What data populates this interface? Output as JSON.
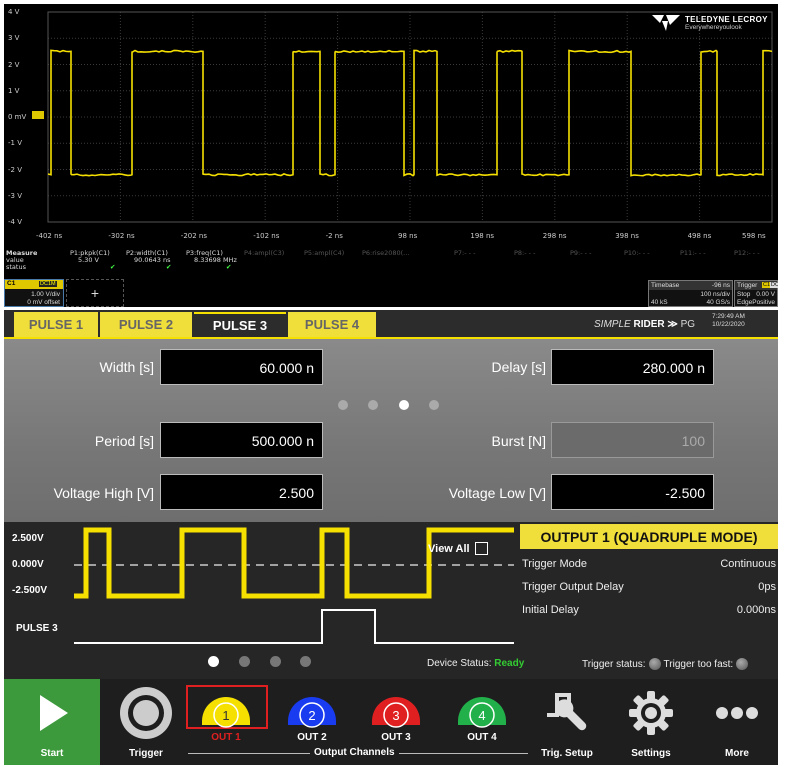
{
  "scope": {
    "y_labels": [
      "4 V",
      "3 V",
      "2 V",
      "1 V",
      "0 mV",
      "-1 V",
      "-2 V",
      "-3 V",
      "-4 V"
    ],
    "x_labels": [
      "-402 ns",
      "-302 ns",
      "-202 ns",
      "-102 ns",
      "-2 ns",
      "98 ns",
      "198 ns",
      "298 ns",
      "398 ns",
      "498 ns",
      "598 ns"
    ],
    "logo_name": "TELEDYNE LECROY",
    "logo_tag": "Everywhereyoulook",
    "measure": {
      "row_labels": [
        "Measure",
        "value",
        "status"
      ],
      "params": [
        {
          "name": "P1:pkpk(C1)",
          "value": "5.30 V",
          "status": "✔"
        },
        {
          "name": "P2:width(C1)",
          "value": "90.0643 ns",
          "status": "✔"
        },
        {
          "name": "P3:freq(C1)",
          "value": "8.33698 MHz",
          "status": "✔"
        },
        {
          "name": "P4:ampl(C3)",
          "value": "",
          "status": ""
        },
        {
          "name": "P5:ampl(C4)",
          "value": "",
          "status": ""
        },
        {
          "name": "P6:rise2080(...",
          "value": "",
          "status": ""
        },
        {
          "name": "P7:- - -",
          "value": "",
          "status": ""
        },
        {
          "name": "P8:- - -",
          "value": "",
          "status": ""
        },
        {
          "name": "P9:- - -",
          "value": "",
          "status": ""
        },
        {
          "name": "P10:- - -",
          "value": "",
          "status": ""
        },
        {
          "name": "P11:- - -",
          "value": "",
          "status": ""
        },
        {
          "name": "P12:- - -",
          "value": "",
          "status": ""
        }
      ]
    },
    "channel": {
      "name": "C1",
      "badge": "DC1M",
      "vdiv": "1.00 V/div",
      "offset": "0 mV offset"
    },
    "add_symbol": "+",
    "timebase": {
      "title": "Timebase",
      "delay": "-96 ns",
      "div": "100 ns/div",
      "samples": "40 kS",
      "rate": "40 GS/s"
    },
    "trigger": {
      "title": "Trigger",
      "ch": "C1",
      "cpl": "DC",
      "mode": "Stop",
      "level": "0.00 V",
      "type": "Edge",
      "slope": "Positive"
    }
  },
  "tabs": [
    "PULSE 1",
    "PULSE 2",
    "PULSE 3",
    "PULSE 4"
  ],
  "active_tab": 2,
  "brand": {
    "prefix": "SIMPLE",
    "name": "RIDER",
    "arrows": "≫",
    "suffix": "PG",
    "time": "7:29:49 AM",
    "date": "10/22/2020"
  },
  "params": {
    "width_label": "Width [s]",
    "width_value": "60.000 n",
    "delay_label": "Delay [s]",
    "delay_value": "280.000 n",
    "period_label": "Period [s]",
    "period_value": "500.000 n",
    "burst_label": "Burst [N]",
    "burst_value": "100",
    "vhigh_label": "Voltage High [V]",
    "vhigh_value": "2.500",
    "vlow_label": "Voltage Low [V]",
    "vlow_value": "-2.500",
    "page_dots": 4,
    "active_page": 2
  },
  "preview": {
    "v_high": "2.500V",
    "v_zero": "0.000V",
    "v_low": "-2.500V",
    "pulse_label": "PULSE 3",
    "view_all": "View All",
    "output_title": "OUTPUT 1 (QUADRUPLE MODE)",
    "rows": [
      {
        "label": "Trigger Mode",
        "value": "Continuous"
      },
      {
        "label": "Trigger Output Delay",
        "value": "0ps"
      },
      {
        "label": "Initial Delay",
        "value": "0.000ns"
      }
    ],
    "device_status_label": "Device Status:",
    "device_status": "Ready",
    "trigger_status_label": "Trigger status:",
    "trigger_fast_label": "Trigger too fast:"
  },
  "toolbar": {
    "start": "Start",
    "trigger": "Trigger",
    "outputs": [
      {
        "num": "1",
        "label": "OUT 1",
        "color": "#f5e000"
      },
      {
        "num": "2",
        "label": "OUT 2",
        "color": "#1a3cf0"
      },
      {
        "num": "3",
        "label": "OUT 3",
        "color": "#e02020"
      },
      {
        "num": "4",
        "label": "OUT 4",
        "color": "#22b04a"
      }
    ],
    "output_channels": "Output Channels",
    "trig_setup": "Trig. Setup",
    "settings": "Settings",
    "more": "More"
  },
  "colors": {
    "accent": "#f5e000",
    "trace": "#f5e000",
    "ready": "#33cc33",
    "start": "#3c9a3c"
  }
}
